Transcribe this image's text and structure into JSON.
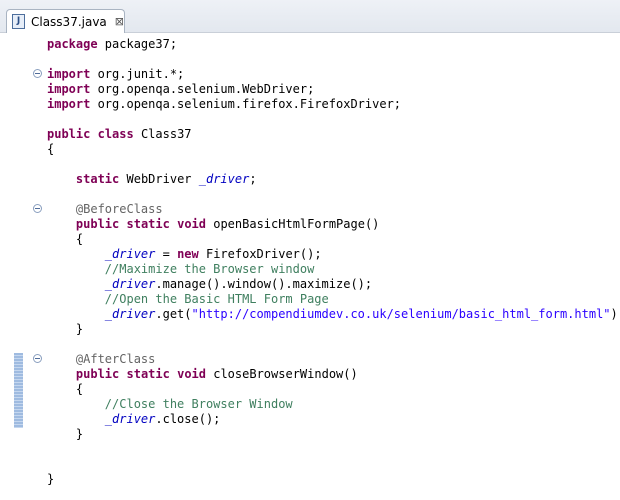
{
  "tab": {
    "label": "Class37.java",
    "icon": "java-file-icon",
    "close_glyph": "⊠"
  },
  "code": {
    "package_kw": "package",
    "package_name": " package37;",
    "import_kw": "import",
    "import1": " org.junit.*;",
    "import2": " org.openqa.selenium.WebDriver;",
    "import3": " org.openqa.selenium.firefox.FirefoxDriver;",
    "public_kw": "public",
    "class_kw": "class",
    "class_name": " Class37",
    "open_brace": "{",
    "close_brace": "}",
    "static_kw": "static",
    "webdriver_type": " WebDriver ",
    "field": "_driver",
    "semicolon": ";",
    "before_class": "@BeforeClass",
    "void_kw": "void",
    "method1": " openBasicHtmlFormPage()",
    "assign": " = ",
    "new_kw": "new",
    "new_rest": " FirefoxDriver();",
    "comment1": "//Maximize the Browser window",
    "maximize_call": ".manage().window().maximize();",
    "comment2": "//Open the Basic HTML Form Page",
    "get_open": ".get(",
    "url": "\"http://compendiumdev.co.uk/selenium/basic_html_form.html\"",
    "get_close": ");",
    "after_class": "@AfterClass",
    "method2": " closeBrowserWindow()",
    "comment3": "//Close the Browser Window",
    "close_call": ".close();"
  },
  "colors": {
    "keyword": "#7f0055",
    "annotation": "#646464",
    "comment": "#3f7f5f",
    "string": "#2a00ff",
    "field": "#0000c0"
  }
}
